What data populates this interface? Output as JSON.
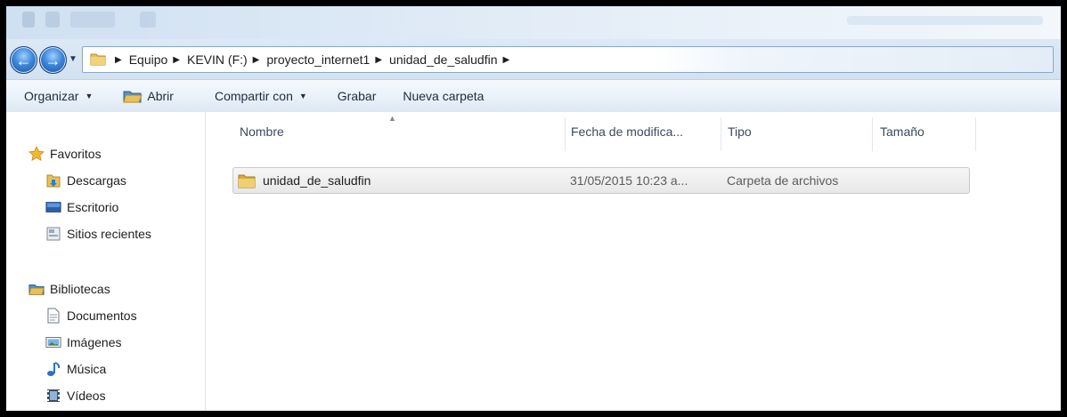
{
  "window": {
    "breadcrumbs": [
      "Equipo",
      "KEVIN (F:)",
      "proyecto_internet1",
      "unidad_de_saludfin"
    ]
  },
  "toolbar": {
    "organize": "Organizar",
    "open": "Abrir",
    "share": "Compartir con",
    "burn": "Grabar",
    "new_folder": "Nueva carpeta"
  },
  "sidebar": {
    "favorites": {
      "label": "Favoritos",
      "items": [
        {
          "label": "Descargas",
          "icon": "downloads-folder-icon"
        },
        {
          "label": "Escritorio",
          "icon": "desktop-icon"
        },
        {
          "label": "Sitios recientes",
          "icon": "recent-places-icon"
        }
      ]
    },
    "libraries": {
      "label": "Bibliotecas",
      "items": [
        {
          "label": "Documentos",
          "icon": "documents-icon"
        },
        {
          "label": "Imágenes",
          "icon": "pictures-icon"
        },
        {
          "label": "Música",
          "icon": "music-icon"
        },
        {
          "label": "Vídeos",
          "icon": "videos-icon"
        }
      ]
    }
  },
  "columns": {
    "name": "Nombre",
    "date": "Fecha de modifica...",
    "type": "Tipo",
    "size": "Tamaño"
  },
  "files": [
    {
      "name": "unidad_de_saludfin",
      "date": "31/05/2015 10:23 a...",
      "type": "Carpeta de archivos",
      "size": ""
    }
  ],
  "colors": {
    "folder": "#e8c15a",
    "nav_button": "#3b86d8",
    "command_bar": "#e9f1f9"
  }
}
